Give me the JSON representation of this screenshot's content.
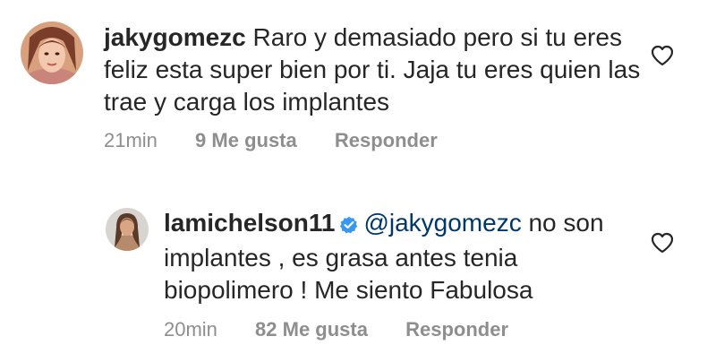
{
  "comments": [
    {
      "username": "jakygomezc",
      "text": "Raro y demasiado pero si tu eres feliz esta super bien por ti. Jaja tu eres quien las trae y carga los implantes",
      "time": "21min",
      "likes": "9 Me gusta",
      "reply": "Responder",
      "verified": false
    },
    {
      "username": "lamichelson11",
      "mention": "@jakygomezc",
      "text": "no son implantes , es grasa antes tenia biopolimero ! Me siento Fabulosa",
      "time": "20min",
      "likes": "82 Me gusta",
      "reply": "Responder",
      "verified": true
    }
  ],
  "colors": {
    "text": "#262626",
    "meta": "#8e8e8e",
    "mention": "#00376b",
    "verified": "#3897f0"
  },
  "icons": {
    "like": "heart-outline-icon",
    "verified": "verified-badge-icon"
  }
}
